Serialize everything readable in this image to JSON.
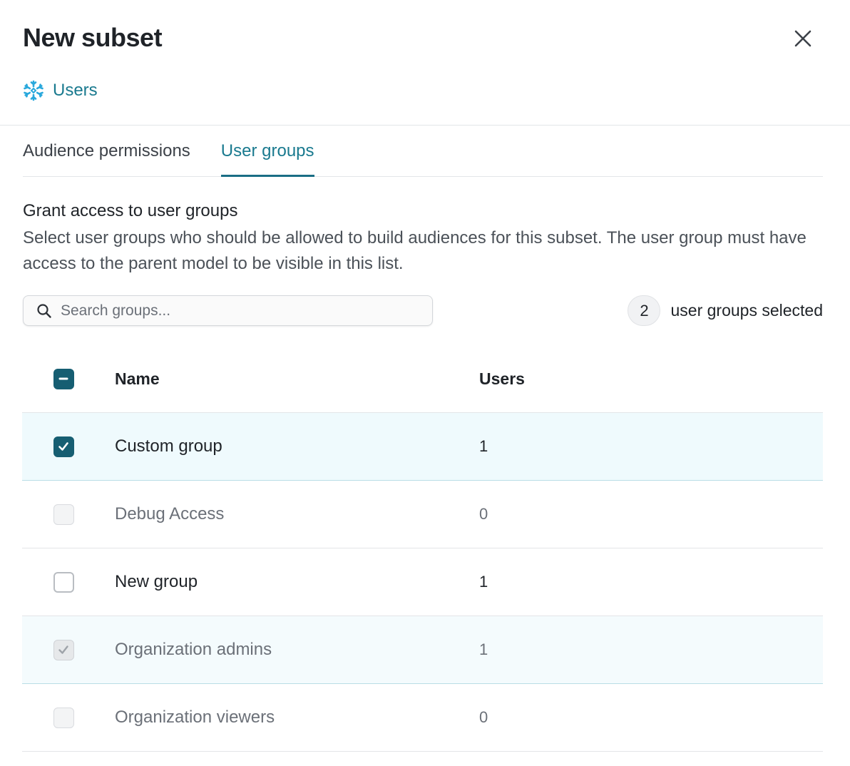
{
  "dialog": {
    "title": "New subset",
    "source_label": "Users"
  },
  "tabs": [
    {
      "label": "Audience permissions",
      "active": false
    },
    {
      "label": "User groups",
      "active": true
    }
  ],
  "section": {
    "title": "Grant access to user groups",
    "description": "Select user groups who should be allowed to build audiences for this subset. The user group must have access to the parent model to be visible in this list."
  },
  "search": {
    "placeholder": "Search groups...",
    "value": ""
  },
  "selection": {
    "count": "2",
    "label": "user groups selected"
  },
  "table": {
    "headers": {
      "name": "Name",
      "users": "Users"
    },
    "rows": [
      {
        "name": "Custom group",
        "users": "1",
        "state": "checked"
      },
      {
        "name": "Debug Access",
        "users": "0",
        "state": "disabled"
      },
      {
        "name": "New group",
        "users": "1",
        "state": "unchecked"
      },
      {
        "name": "Organization admins",
        "users": "1",
        "state": "disabled-checked"
      },
      {
        "name": "Organization viewers",
        "users": "0",
        "state": "disabled"
      }
    ]
  },
  "colors": {
    "accent": "#1a7a8f",
    "checkbox": "#165e72",
    "selected_row": "#effafd"
  },
  "icons": {
    "close": "close-icon",
    "source": "snowflake-icon",
    "search": "search-icon"
  }
}
